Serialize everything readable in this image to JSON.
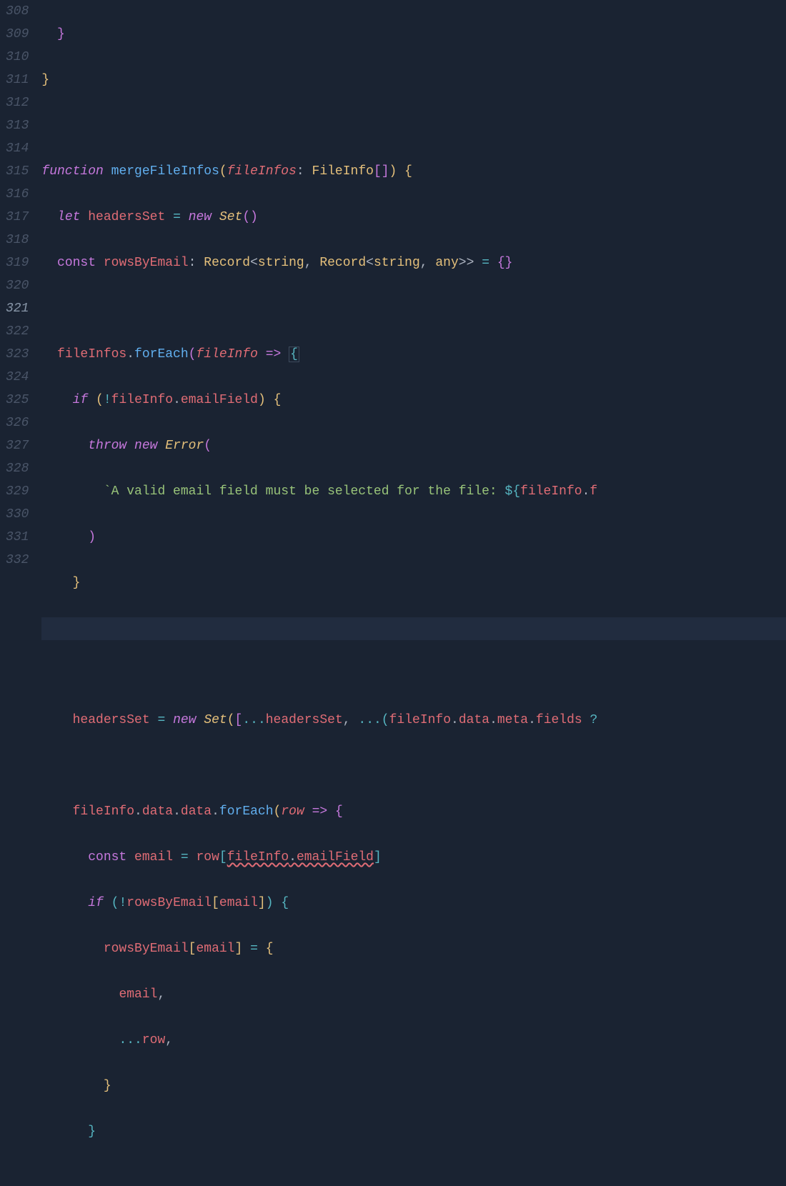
{
  "lineNumbers": [
    "308",
    "309",
    "310",
    "311",
    "312",
    "313",
    "314",
    "315",
    "316",
    "317",
    "318",
    "319",
    "320",
    "321",
    "322",
    "323",
    "324",
    "325",
    "326",
    "327",
    "328",
    "329",
    "330",
    "331",
    "332"
  ],
  "activeLine": "321",
  "code": {
    "l308": {},
    "l309": {
      "brace": "}"
    },
    "l310": {},
    "l311": {
      "kw_function": "function",
      "funcname": "mergeFileInfos",
      "param": "fileInfos",
      "type": "FileInfo",
      "brackets": "[]",
      "brace_open": "{"
    },
    "l312": {
      "kw_let": "let",
      "var": "headersSet",
      "eq": "=",
      "kw_new": "new",
      "cls": "Set",
      "parens": "()"
    },
    "l313": {
      "kw_const": "const",
      "var": "rowsByEmail",
      "type_record": "Record",
      "type_string": "string",
      "type_record2": "Record",
      "type_string2": "string",
      "type_any": "any",
      "eq": "=",
      "empty_obj": "{}"
    },
    "l314": {},
    "l315": {
      "obj": "fileInfos",
      "method": "forEach",
      "param": "fileInfo",
      "arrow": "=>",
      "brace": "{"
    },
    "l316": {
      "kw_if": "if",
      "not": "!",
      "obj": "fileInfo",
      "prop": "emailField",
      "brace": "{"
    },
    "l317": {
      "kw_throw": "throw",
      "kw_new": "new",
      "cls": "Error",
      "paren": "("
    },
    "l318": {
      "templ_text": "`A valid email field must be selected for the file: ",
      "templ_expr_open": "${",
      "templ_obj": "fileInfo",
      "templ_prop": "f"
    },
    "l319": {
      "paren": ")"
    },
    "l320": {
      "brace": "}"
    },
    "l321": {},
    "l322": {},
    "l323": {
      "var": "headersSet",
      "eq": "=",
      "kw_new": "new",
      "cls": "Set",
      "spread1": "...",
      "arg1": "headersSet",
      "spread2": "...",
      "obj": "fileInfo",
      "prop1": "data",
      "prop2": "meta",
      "prop3": "fields",
      "q": "?"
    },
    "l324": {},
    "l325": {
      "obj": "fileInfo",
      "prop1": "data",
      "prop2": "data",
      "method": "forEach",
      "param": "row",
      "arrow": "=>",
      "brace": "{"
    },
    "l326": {
      "kw_const": "const",
      "var": "email",
      "eq": "=",
      "obj": "row",
      "idx_obj": "fileInfo",
      "idx_prop": "emailField"
    },
    "l327": {
      "kw_if": "if",
      "not": "!",
      "obj": "rowsByEmail",
      "idx": "email",
      "brace": "{"
    },
    "l328": {
      "obj": "rowsByEmail",
      "idx": "email",
      "eq": "=",
      "brace": "{"
    },
    "l329": {
      "prop": "email"
    },
    "l330": {
      "spread": "...",
      "obj": "row"
    },
    "l331": {
      "brace": "}"
    }
  }
}
